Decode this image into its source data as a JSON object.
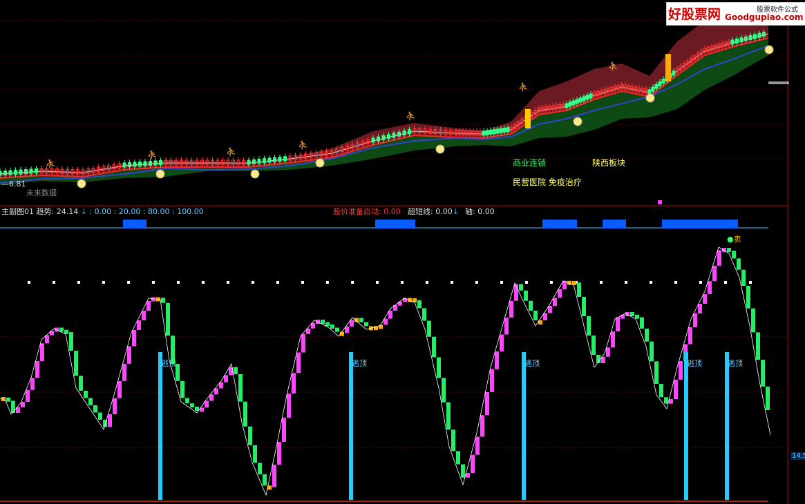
{
  "watermark": {
    "brand": "好股票网",
    "url": "Goodgupiao.com",
    "sub": "股票软件公式"
  },
  "main_panel": {
    "price_label": "6.81",
    "future_data": "未来数据",
    "sector_tags": [
      "商业连锁",
      "陕西板块",
      "民营医院 免疫治疗"
    ]
  },
  "sub_panel": {
    "name": "主副图01",
    "trend_label": "趋势:",
    "trend_value": "24.14",
    "levels": ": 0.00 : 20.00 : 80.00 : 100.00",
    "start_label": "股价准备启动:",
    "start_value": "0.00",
    "ultra_label": "超短线:",
    "ultra_value": "0.00",
    "axis_label": "轴:",
    "axis_value": "0.00",
    "sell_label": "卖",
    "escape_label": "逃顶",
    "right_value": "14.5"
  },
  "colors": {
    "up": "#ff44ff",
    "down": "#22ee66",
    "flat": "#ffaa00",
    "escape": "#22ccff",
    "candle_up": "#ff3333",
    "candle_down": "#33ff88",
    "ma_fast": "#ff2222",
    "ma_slow": "#3344cc",
    "band_upper": "#6b1a22",
    "band_lower": "#0e4a14"
  }
}
